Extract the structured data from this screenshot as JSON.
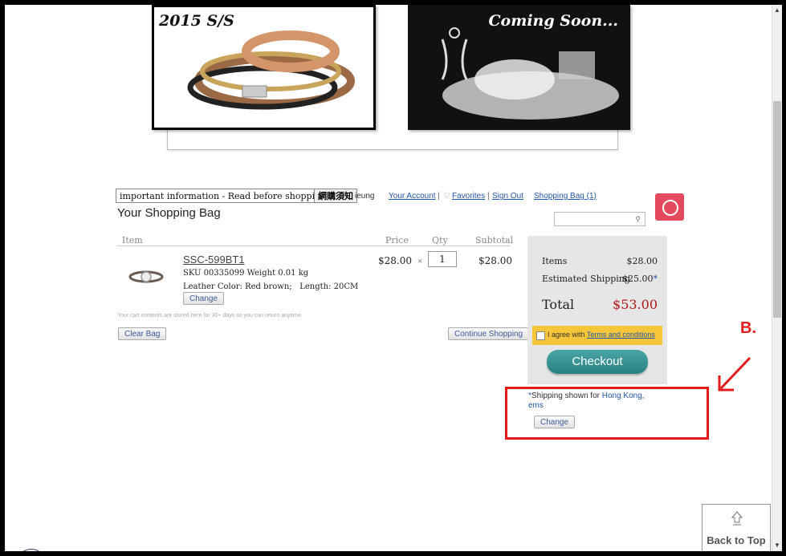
{
  "banners": {
    "left_caption": "2015 S/S",
    "right_caption": "Coming Soon..."
  },
  "info_bar": {
    "important_label": "important information - Read before shopping",
    "important_cn": "網購須知",
    "user_fragment": "ieung",
    "account_link": "Your Account",
    "favorites_link": "Favorites",
    "signout_link": "Sign Out",
    "bag_link": "Shopping Bag (1)",
    "sep": "|"
  },
  "page_title": "Your Shopping Bag",
  "table": {
    "headers": [
      "Item",
      "Price",
      "Qty",
      "Subtotal"
    ]
  },
  "item": {
    "name": "SSC-599BT1",
    "sku": "SKU 00335099   Weight 0.01 kg",
    "options": "Leather Color: Red brown;   Length: 20CM",
    "change_label": "Change",
    "price": "$28.00",
    "times": "×",
    "qty": "1",
    "subtotal": "$28.00"
  },
  "cart_note": "Your cart contents are stored here for 30+ days so you can return anytime.",
  "buttons": {
    "clear_bag": "Clear Bag",
    "continue_shopping": "Continue Shopping",
    "checkout": "Checkout",
    "shipping_change": "Change",
    "back_to_top": "Back to Top"
  },
  "summary": {
    "items_label": "Items",
    "items_value": "$28.00",
    "shipping_label": "Estimated Shipping",
    "shipping_value": "$25.00",
    "shipping_asterisk": "*",
    "total_label": "Total",
    "total_value": "$53.00",
    "agree_text": "I agree with ",
    "agree_link": "Terms and conditions"
  },
  "shipping_note": {
    "asterisk": "*",
    "prefix": "Shipping shown for ",
    "country": "Hong Kong",
    "comma": ",",
    "method": "ems"
  },
  "annotation": {
    "label": "B."
  },
  "colors": {
    "annotation_red": "#e31b1b",
    "checkout_teal": "#2a7f80",
    "total_red": "#b01818",
    "agree_yellow": "#f6c53a",
    "chat_pink": "#e44a5e"
  }
}
